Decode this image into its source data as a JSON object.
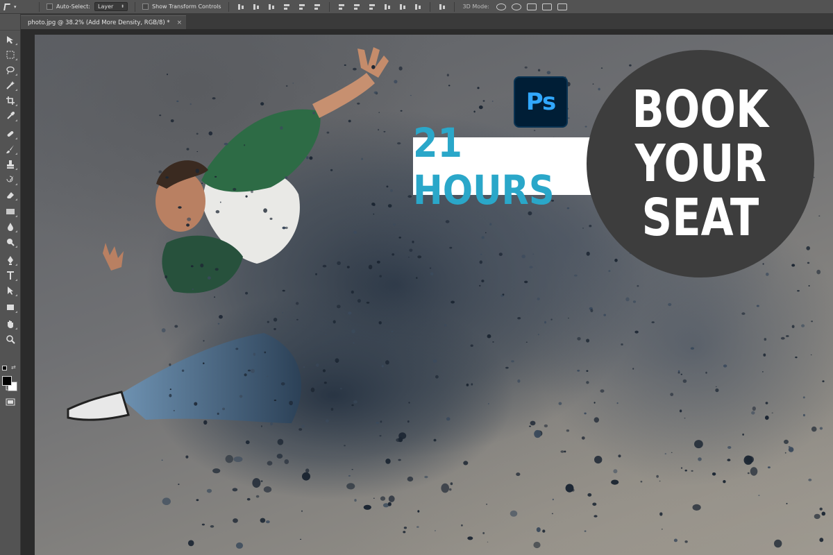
{
  "options_bar": {
    "auto_select_label": "Auto-Select:",
    "layer_select_value": "Layer",
    "show_transform_label": "Show Transform Controls",
    "mode_3d_label": "3D Mode:"
  },
  "document_tab": {
    "title": "photo.jpg @ 38.2% (Add More Density, RGB/8) *",
    "close_glyph": "×"
  },
  "promo": {
    "logo_text": "Ps",
    "hours_text": "21 HOURS",
    "cta_lines": [
      "BOOK",
      "YOUR",
      "SEAT"
    ]
  },
  "colors": {
    "ui_panel": "#535353",
    "canvas_bg": "#2b2b2b",
    "ps_logo_bg": "#001e36",
    "ps_logo_text": "#31a8ff",
    "hours_text": "#2aa7c9",
    "cta_circle": "#3d3d3d"
  },
  "tools": [
    "move-tool-icon",
    "marquee-tool-icon",
    "lasso-tool-icon",
    "magic-wand-icon",
    "crop-tool-icon",
    "eyedropper-icon",
    "healing-brush-icon",
    "brush-tool-icon",
    "clone-stamp-icon",
    "history-brush-icon",
    "eraser-icon",
    "gradient-tool-icon",
    "blur-tool-icon",
    "dodge-tool-icon",
    "pen-tool-icon",
    "type-tool-icon",
    "path-selection-icon",
    "rectangle-tool-icon",
    "hand-tool-icon",
    "zoom-tool-icon",
    "quick-mask-icon",
    "screen-mode-icon"
  ]
}
